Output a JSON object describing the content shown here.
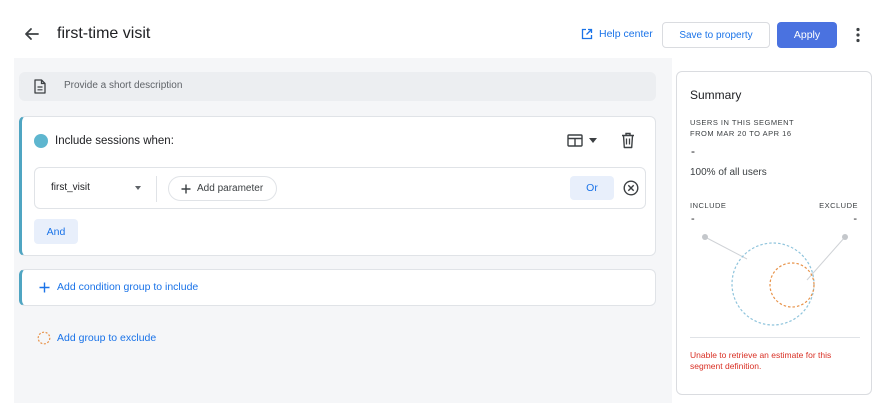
{
  "header": {
    "title": "first-time visit",
    "help_label": "Help center",
    "save_label": "Save to property",
    "apply_label": "Apply"
  },
  "description": {
    "placeholder": "Provide a short description"
  },
  "include_group": {
    "title": "Include sessions when:",
    "condition": {
      "event": "first_visit",
      "add_parameter_label": "Add parameter",
      "or_label": "Or"
    },
    "and_label": "And"
  },
  "add_condition_group_label": "Add condition group to include",
  "add_exclude_group_label": "Add group to exclude",
  "summary": {
    "title": "Summary",
    "users_label": "USERS IN THIS SEGMENT",
    "date_range": "FROM MAR 20 TO APR 16",
    "users_value": "-",
    "percent_text": "100% of all users",
    "include_label": "INCLUDE",
    "include_value": "-",
    "exclude_label": "EXCLUDE",
    "exclude_value": "-",
    "error_text": "Unable to retrieve an estimate for this segment definition."
  },
  "colors": {
    "accent": "#1a73e8",
    "apply_button": "#4a72e0",
    "include_dot": "#5eb6cf",
    "exclude_ring": "#e8934a",
    "error": "#d93025"
  },
  "icons": {
    "back": "arrow-left-icon",
    "help": "open-in-new-icon",
    "more": "more-vert-icon",
    "description": "document-icon",
    "view": "view-layout-icon",
    "delete": "trash-icon",
    "close": "cancel-circle-icon"
  }
}
